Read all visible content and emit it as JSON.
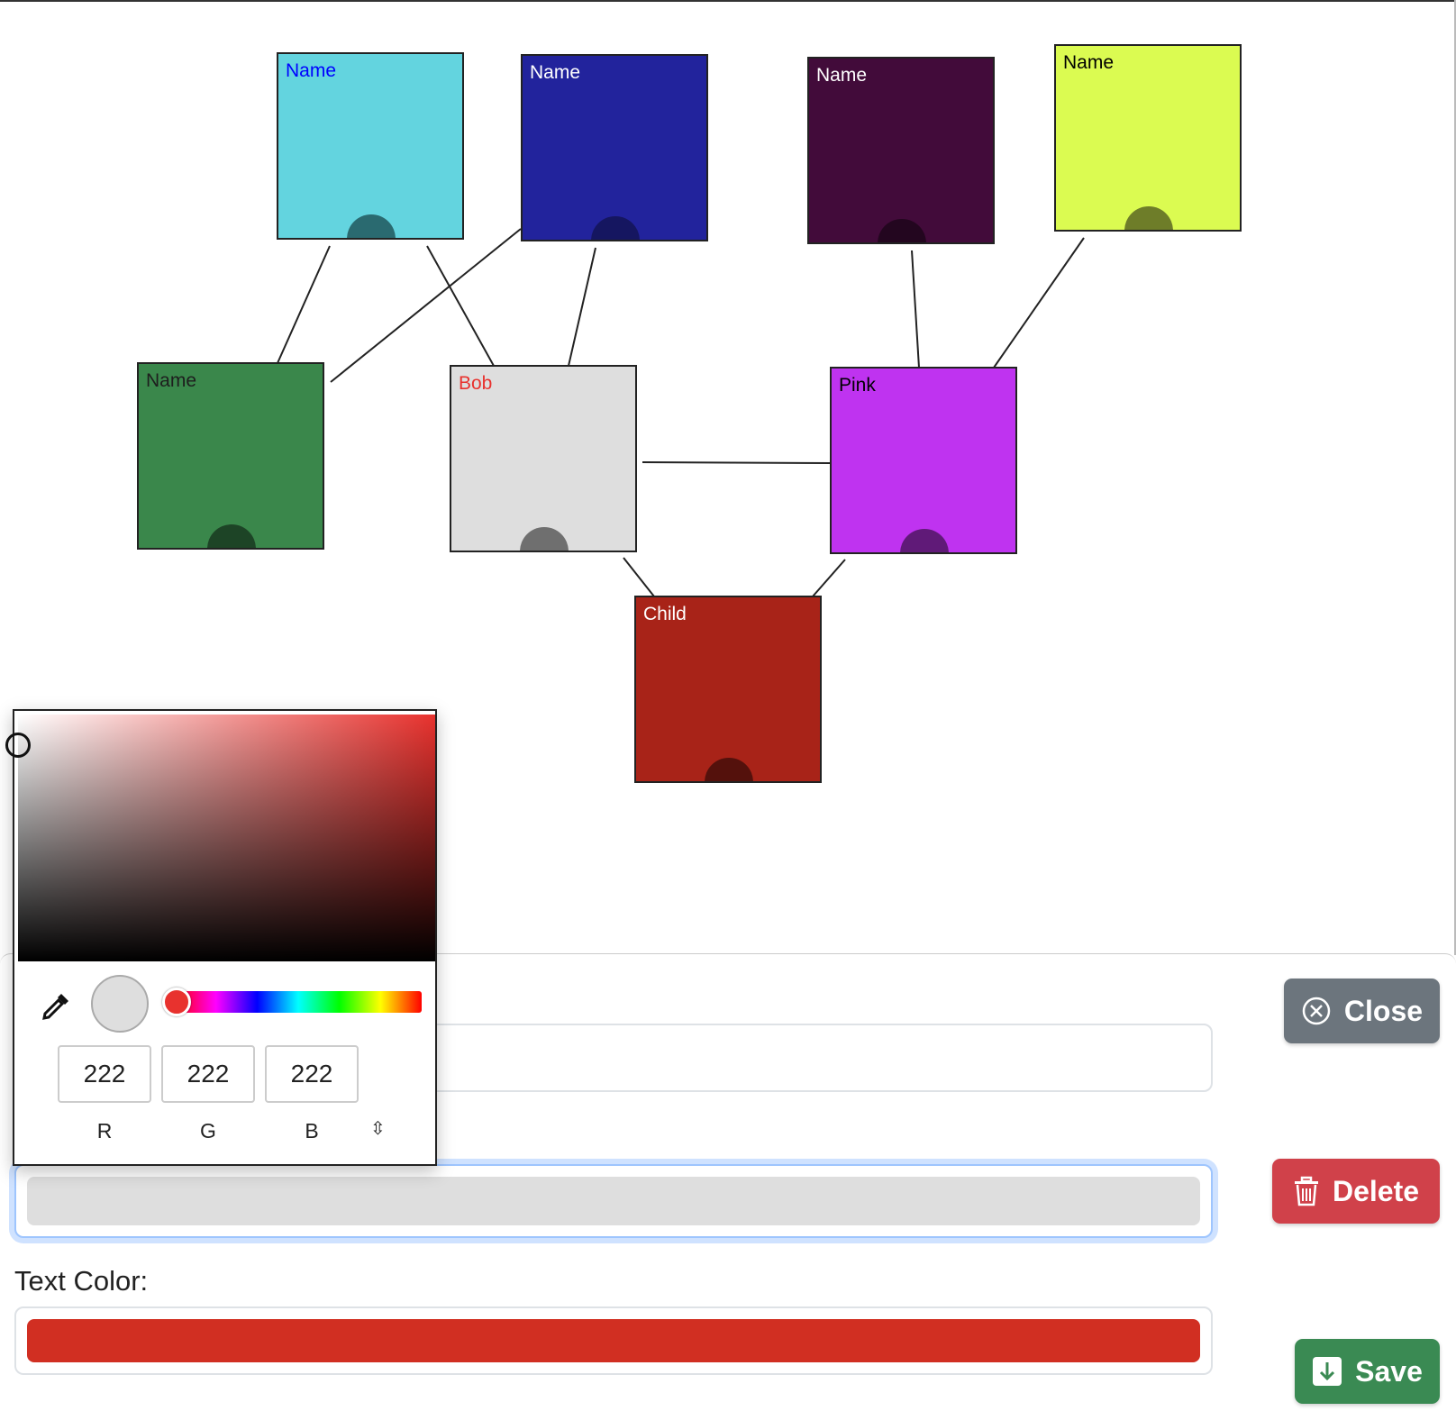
{
  "tree": {
    "nodes": [
      {
        "id": "n1",
        "name": "Name",
        "bg": "#63d4df",
        "text": "#0000ff",
        "handle": "#2a6a70"
      },
      {
        "id": "n2",
        "name": "Name",
        "bg": "#22239c",
        "text": "#ffffff",
        "handle": "#151660"
      },
      {
        "id": "n3",
        "name": "Name",
        "bg": "#420b3a",
        "text": "#ffffff",
        "handle": "#23061f"
      },
      {
        "id": "n4",
        "name": "Name",
        "bg": "#dbfb51",
        "text": "#000000",
        "handle": "#6e7d29"
      },
      {
        "id": "n5",
        "name": "Name",
        "bg": "#3a874b",
        "text": "#1e1e1e",
        "handle": "#1d4426"
      },
      {
        "id": "n6",
        "name": "Bob",
        "bg": "#dedede",
        "text": "#e8322e",
        "handle": "#6f6f6f"
      },
      {
        "id": "n7",
        "name": "Pink",
        "bg": "#bf33f0",
        "text": "#000000",
        "handle": "#601a78"
      },
      {
        "id": "n8",
        "name": "Child",
        "bg": "#a82318",
        "text": "#ffffff",
        "handle": "#54110c"
      }
    ]
  },
  "form": {
    "text_color_label": "Text Color:",
    "bg_color_value": "#dedede",
    "text_color_value": "#d12f22"
  },
  "buttons": {
    "close_label": "Close",
    "delete_label": "Delete",
    "save_label": "Save"
  },
  "picker": {
    "hue_color": "#e8322e",
    "r": "222",
    "g": "222",
    "b": "222",
    "r_label": "R",
    "g_label": "G",
    "b_label": "B",
    "mode_toggle_icon": "up-down-arrows-icon",
    "eyedropper_icon": "eyedropper-icon"
  },
  "colors": {
    "close": "#6c757d",
    "delete": "#d0414a",
    "save": "#3a8a53"
  }
}
